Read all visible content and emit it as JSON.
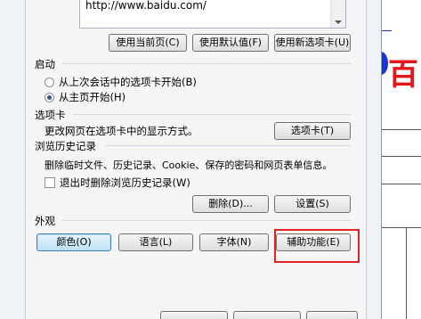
{
  "home_page": {
    "url_text": "http://www.baidu.com/"
  },
  "home_buttons": {
    "use_current": "使用当前页(C)",
    "use_default": "使用默认值(F)",
    "use_new_tab": "使用新选项卡(U)"
  },
  "startup": {
    "title": "启动",
    "option_last_session": "从上次会话中的选项卡开始(B)",
    "option_home_page": "从主页开始(H)",
    "selected": "option_home_page"
  },
  "tabs": {
    "title": "选项卡",
    "description": "更改网页在选项卡中的显示方式。",
    "button": "选项卡(T)"
  },
  "history": {
    "title": "浏览历史记录",
    "description": "删除临时文件、历史记录、Cookie、保存的密码和网页表单信息。",
    "checkbox_label": "退出时删除浏览历史记录(W)",
    "checkbox_checked": false,
    "delete_button": "删除(D)...",
    "settings_button": "设置(S)"
  },
  "appearance": {
    "title": "外观",
    "colors_button": "颜色(O)",
    "languages_button": "语言(L)",
    "fonts_button": "字体(N)",
    "accessibility_button": "辅助功能(E)"
  },
  "background": {
    "logo_text": "百"
  },
  "colors": {
    "highlight": "#e32424",
    "logo_red": "#e3171b",
    "logo_blue": "#1b33d6"
  }
}
